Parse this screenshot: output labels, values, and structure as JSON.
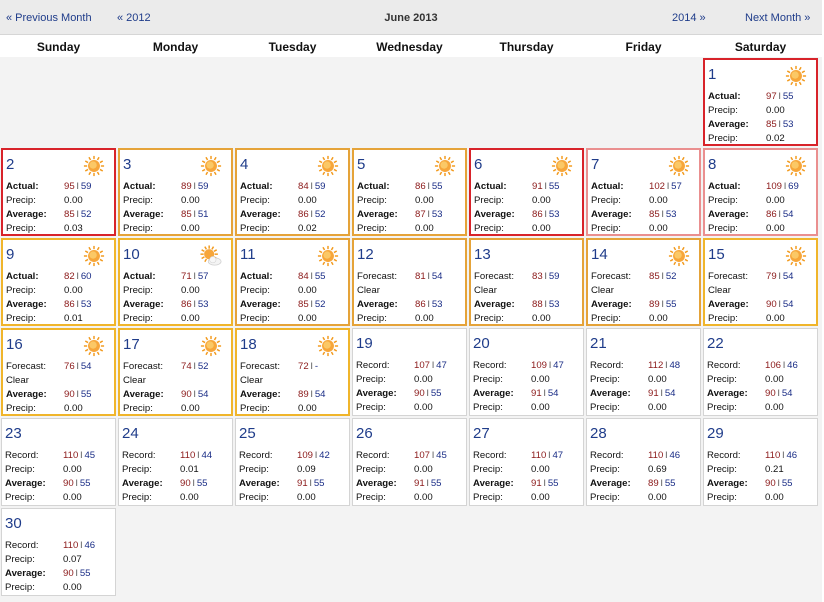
{
  "nav": {
    "prev_month": "« Previous Month",
    "prev_year": "« 2012",
    "title": "June 2013",
    "next_year": "2014 »",
    "next_month": "Next Month »"
  },
  "weekdays": [
    "Sunday",
    "Monday",
    "Tuesday",
    "Wednesday",
    "Thursday",
    "Friday",
    "Saturday"
  ],
  "colors": {
    "actual_red": "#d8232a",
    "light_red": "#ea8f8f",
    "orange": "#e5a339",
    "gold": "#f0b52b",
    "none": "#d4d4d4"
  },
  "days": [
    {
      "day": "1",
      "border": "red",
      "icon": "sun-icon",
      "kind": "actual",
      "label1": "Actual:",
      "hi": "97",
      "lo": "55",
      "precip": "0.00",
      "avg_hi": "85",
      "avg_lo": "53",
      "avg_precip": "0.02"
    },
    {
      "day": "2",
      "border": "red",
      "icon": "sun-icon",
      "kind": "actual",
      "label1": "Actual:",
      "hi": "95",
      "lo": "59",
      "precip": "0.00",
      "avg_hi": "85",
      "avg_lo": "52",
      "avg_precip": "0.03"
    },
    {
      "day": "3",
      "border": "orange",
      "icon": "sun-icon",
      "kind": "actual",
      "label1": "Actual:",
      "hi": "89",
      "lo": "59",
      "precip": "0.00",
      "avg_hi": "85",
      "avg_lo": "51",
      "avg_precip": "0.00"
    },
    {
      "day": "4",
      "border": "orange",
      "icon": "sun-icon",
      "kind": "actual",
      "label1": "Actual:",
      "hi": "84",
      "lo": "59",
      "precip": "0.00",
      "avg_hi": "86",
      "avg_lo": "52",
      "avg_precip": "0.02"
    },
    {
      "day": "5",
      "border": "orange",
      "icon": "sun-icon",
      "kind": "actual",
      "label1": "Actual:",
      "hi": "86",
      "lo": "55",
      "precip": "0.00",
      "avg_hi": "87",
      "avg_lo": "53",
      "avg_precip": "0.00"
    },
    {
      "day": "6",
      "border": "red",
      "icon": "sun-icon",
      "kind": "actual",
      "label1": "Actual:",
      "hi": "91",
      "lo": "55",
      "precip": "0.00",
      "avg_hi": "86",
      "avg_lo": "53",
      "avg_precip": "0.00"
    },
    {
      "day": "7",
      "border": "lred",
      "icon": "sun-icon",
      "kind": "actual",
      "label1": "Actual:",
      "hi": "102",
      "lo": "57",
      "precip": "0.00",
      "avg_hi": "85",
      "avg_lo": "53",
      "avg_precip": "0.00"
    },
    {
      "day": "8",
      "border": "lred",
      "icon": "sun-icon",
      "kind": "actual",
      "label1": "Actual:",
      "hi": "109",
      "lo": "69",
      "precip": "0.00",
      "avg_hi": "86",
      "avg_lo": "54",
      "avg_precip": "0.00"
    },
    {
      "day": "9",
      "border": "gold",
      "icon": "sun-icon",
      "kind": "actual",
      "label1": "Actual:",
      "hi": "82",
      "lo": "60",
      "precip": "0.00",
      "avg_hi": "86",
      "avg_lo": "53",
      "avg_precip": "0.01"
    },
    {
      "day": "10",
      "border": "gold",
      "icon": "partly-cloudy-icon",
      "kind": "actual",
      "label1": "Actual:",
      "hi": "71",
      "lo": "57",
      "precip": "0.00",
      "avg_hi": "86",
      "avg_lo": "53",
      "avg_precip": "0.00"
    },
    {
      "day": "11",
      "border": "orange",
      "icon": "sun-icon",
      "kind": "actual",
      "label1": "Actual:",
      "hi": "84",
      "lo": "55",
      "precip": "0.00",
      "avg_hi": "85",
      "avg_lo": "52",
      "avg_precip": "0.00"
    },
    {
      "day": "12",
      "border": "orange",
      "icon": "",
      "kind": "forecast",
      "label1": "Forecast:",
      "hi": "81",
      "lo": "54",
      "condition": "Clear",
      "avg_hi": "86",
      "avg_lo": "53",
      "avg_precip": "0.00"
    },
    {
      "day": "13",
      "border": "orange",
      "icon": "",
      "kind": "forecast",
      "label1": "Forecast:",
      "hi": "83",
      "lo": "59",
      "condition": "Clear",
      "avg_hi": "88",
      "avg_lo": "53",
      "avg_precip": "0.00"
    },
    {
      "day": "14",
      "border": "orange",
      "icon": "sun-icon",
      "kind": "forecast",
      "label1": "Forecast:",
      "hi": "85",
      "lo": "52",
      "condition": "Clear",
      "avg_hi": "89",
      "avg_lo": "55",
      "avg_precip": "0.00"
    },
    {
      "day": "15",
      "border": "gold",
      "icon": "sun-icon",
      "kind": "forecast",
      "label1": "Forecast:",
      "hi": "79",
      "lo": "54",
      "condition": "Clear",
      "avg_hi": "90",
      "avg_lo": "54",
      "avg_precip": "0.00"
    },
    {
      "day": "16",
      "border": "gold",
      "icon": "sun-icon",
      "kind": "forecast",
      "label1": "Forecast:",
      "hi": "76",
      "lo": "54",
      "condition": "Clear",
      "avg_hi": "90",
      "avg_lo": "55",
      "avg_precip": "0.00"
    },
    {
      "day": "17",
      "border": "gold",
      "icon": "sun-icon",
      "kind": "forecast",
      "label1": "Forecast:",
      "hi": "74",
      "lo": "52",
      "condition": "Clear",
      "avg_hi": "90",
      "avg_lo": "54",
      "avg_precip": "0.00"
    },
    {
      "day": "18",
      "border": "gold",
      "icon": "sun-icon",
      "kind": "forecast",
      "label1": "Forecast:",
      "hi": "72",
      "lo": "-",
      "condition": "Clear",
      "avg_hi": "89",
      "avg_lo": "54",
      "avg_precip": "0.00"
    },
    {
      "day": "19",
      "border": "none",
      "icon": "",
      "kind": "record",
      "label1": "Record:",
      "hi": "107",
      "lo": "47",
      "precip": "0.00",
      "avg_hi": "90",
      "avg_lo": "55",
      "avg_precip": "0.00"
    },
    {
      "day": "20",
      "border": "none",
      "icon": "",
      "kind": "record",
      "label1": "Record:",
      "hi": "109",
      "lo": "47",
      "precip": "0.00",
      "avg_hi": "91",
      "avg_lo": "54",
      "avg_precip": "0.00"
    },
    {
      "day": "21",
      "border": "none",
      "icon": "",
      "kind": "record",
      "label1": "Record:",
      "hi": "112",
      "lo": "48",
      "precip": "0.00",
      "avg_hi": "91",
      "avg_lo": "54",
      "avg_precip": "0.00"
    },
    {
      "day": "22",
      "border": "none",
      "icon": "",
      "kind": "record",
      "label1": "Record:",
      "hi": "106",
      "lo": "46",
      "precip": "0.00",
      "avg_hi": "90",
      "avg_lo": "54",
      "avg_precip": "0.00"
    },
    {
      "day": "23",
      "border": "none",
      "icon": "",
      "kind": "record",
      "label1": "Record:",
      "hi": "110",
      "lo": "45",
      "precip": "0.00",
      "avg_hi": "90",
      "avg_lo": "55",
      "avg_precip": "0.00"
    },
    {
      "day": "24",
      "border": "none",
      "icon": "",
      "kind": "record",
      "label1": "Record:",
      "hi": "110",
      "lo": "44",
      "precip": "0.01",
      "avg_hi": "90",
      "avg_lo": "55",
      "avg_precip": "0.00"
    },
    {
      "day": "25",
      "border": "none",
      "icon": "",
      "kind": "record",
      "label1": "Record:",
      "hi": "109",
      "lo": "42",
      "precip": "0.09",
      "avg_hi": "91",
      "avg_lo": "55",
      "avg_precip": "0.00"
    },
    {
      "day": "26",
      "border": "none",
      "icon": "",
      "kind": "record",
      "label1": "Record:",
      "hi": "107",
      "lo": "45",
      "precip": "0.00",
      "avg_hi": "91",
      "avg_lo": "55",
      "avg_precip": "0.00"
    },
    {
      "day": "27",
      "border": "none",
      "icon": "",
      "kind": "record",
      "label1": "Record:",
      "hi": "110",
      "lo": "47",
      "precip": "0.00",
      "avg_hi": "91",
      "avg_lo": "55",
      "avg_precip": "0.00"
    },
    {
      "day": "28",
      "border": "none",
      "icon": "",
      "kind": "record",
      "label1": "Record:",
      "hi": "110",
      "lo": "46",
      "precip": "0.69",
      "avg_hi": "89",
      "avg_lo": "55",
      "avg_precip": "0.00"
    },
    {
      "day": "29",
      "border": "none",
      "icon": "",
      "kind": "record",
      "label1": "Record:",
      "hi": "110",
      "lo": "46",
      "precip": "0.21",
      "avg_hi": "90",
      "avg_lo": "55",
      "avg_precip": "0.00"
    },
    {
      "day": "30",
      "border": "none",
      "icon": "",
      "kind": "record",
      "label1": "Record:",
      "hi": "110",
      "lo": "46",
      "precip": "0.07",
      "avg_hi": "90",
      "avg_lo": "55",
      "avg_precip": "0.00"
    }
  ],
  "labels": {
    "precip": "Precip:",
    "average": "Average:",
    "sep": "l"
  }
}
